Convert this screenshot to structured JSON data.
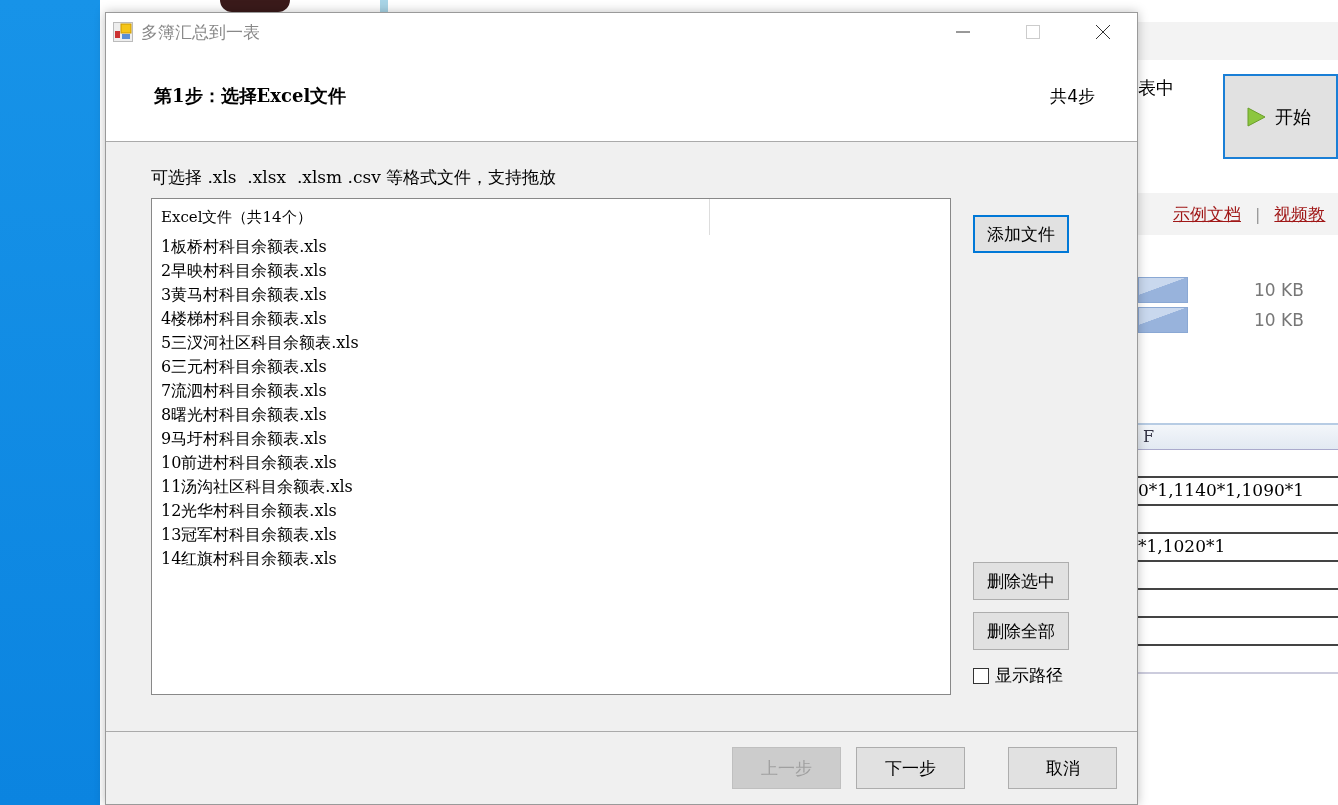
{
  "window": {
    "title": "多簿汇总到一表"
  },
  "header": {
    "step_title": "第1步：选择Excel文件",
    "step_count": "共4步"
  },
  "hint": "可选择 .xls  .xlsx  .xlsm .csv 等格式文件，支持拖放",
  "file_list": {
    "column_header": "Excel文件（共14个）",
    "items": [
      {
        "name": "1板桥村科目余额表.xls",
        "selected": false
      },
      {
        "name": "2早映村科目余额表.xls",
        "selected": false
      },
      {
        "name": "3黄马村科目余额表.xls",
        "selected": false
      },
      {
        "name": "4楼梯村科目余额表.xls",
        "selected": false
      },
      {
        "name": "5三汊河社区科目余额表.xls",
        "selected": false
      },
      {
        "name": "6三元村科目余额表.xls",
        "selected": false
      },
      {
        "name": "7流泗村科目余额表.xls",
        "selected": false
      },
      {
        "name": "8曙光村科目余额表.xls",
        "selected": false
      },
      {
        "name": "9马圩村科目余额表.xls",
        "selected": false
      },
      {
        "name": "10前进村科目余额表.xls",
        "selected": false
      },
      {
        "name": "11汤沟社区科目余额表.xls",
        "selected": false
      },
      {
        "name": "12光华村科目余额表.xls",
        "selected": false
      },
      {
        "name": "13冠军村科目余额表.xls",
        "selected": false
      },
      {
        "name": "14红旗村科目余额表.xls",
        "selected": false
      }
    ]
  },
  "side_buttons": [
    {
      "label": "添加文件",
      "focused": true
    },
    {
      "label": "删除选中",
      "focused": false
    },
    {
      "label": "删除全部",
      "focused": false
    }
  ],
  "show_path": {
    "label": "显示路径",
    "checked": false
  },
  "footer_buttons": [
    {
      "label": "上一步",
      "disabled": true
    },
    {
      "label": "下一步",
      "disabled": false
    },
    {
      "label": "取消",
      "disabled": false
    }
  ],
  "background_app": {
    "status_text": "表中",
    "start_button": "开始",
    "links": [
      "示例文档",
      "视频教"
    ],
    "separator": "|",
    "file_sizes": [
      "10 KB",
      "10 KB"
    ],
    "sheet": {
      "column_header": "F",
      "rows": [
        "0*1,1140*1,1090*1",
        "*1,1020*1"
      ]
    }
  }
}
